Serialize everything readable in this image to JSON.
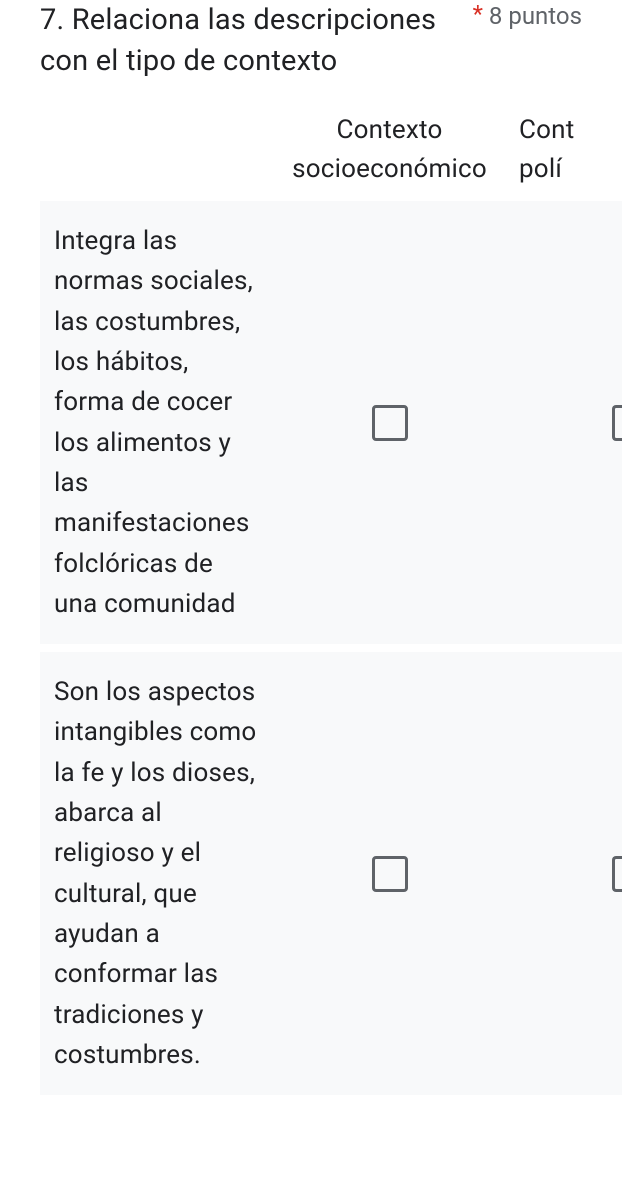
{
  "question": {
    "number_and_title": "7. Relaciona las descripciones con el tipo de contexto",
    "required_mark": "*",
    "points": "8 puntos"
  },
  "grid": {
    "columns": [
      "Contexto socioeconómico",
      "Cont\npolí"
    ],
    "rows": [
      {
        "label": "Integra las normas sociales, las costumbres, los hábitos, forma de cocer los alimentos y las manifestaciones folclóricas de una comunidad"
      },
      {
        "label": "Son los aspectos intangibles como la fe y los dioses, abarca al religioso y el cultural, que ayudan a conformar las tradiciones y costumbres."
      }
    ]
  }
}
